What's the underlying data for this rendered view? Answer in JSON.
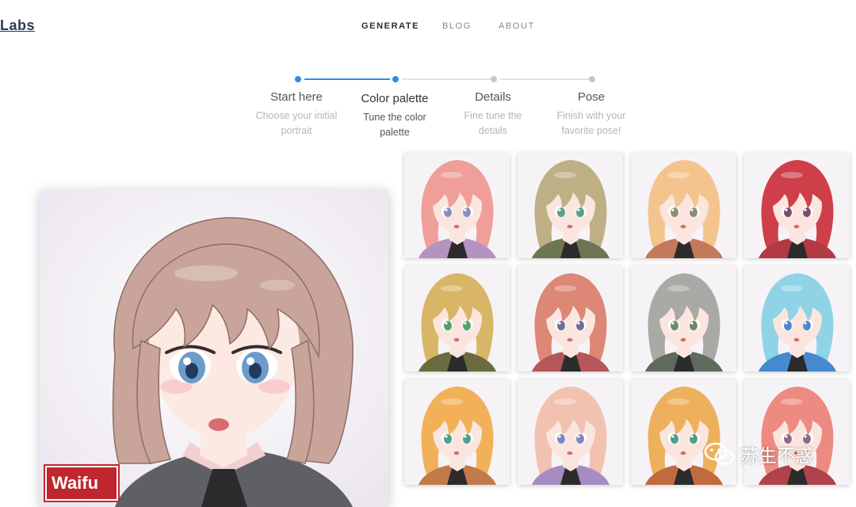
{
  "logo": {
    "text": "Labs"
  },
  "nav": {
    "items": [
      {
        "label": "GENERATE",
        "active": true
      },
      {
        "label": "BLOG",
        "active": false
      },
      {
        "label": "ABOUT",
        "active": false
      }
    ]
  },
  "stepper": {
    "current_step": 2,
    "steps": [
      {
        "title": "Start here",
        "description": "Choose your initial portrait"
      },
      {
        "title": "Color palette",
        "description": "Tune the color palette"
      },
      {
        "title": "Details",
        "description": "Fine tune the details"
      },
      {
        "title": "Pose",
        "description": "Finish with your favorite pose!"
      }
    ]
  },
  "main_portrait": {
    "hair": "#c8a49a",
    "hair_dark": "#8e6d68",
    "eyes": "#6c9bc9",
    "skin": "#fbe9e2",
    "shirt": "#5f5f66",
    "collar": "#f2cfd3",
    "tie": "#2b2b2b",
    "badge_text": "Waifu"
  },
  "variants": [
    {
      "hair": "#ef9e99",
      "eyes": "#8a8cc4",
      "shirt": "#b493c1"
    },
    {
      "hair": "#bfaf85",
      "eyes": "#5e9d86",
      "shirt": "#6e7553"
    },
    {
      "hair": "#f4c48f",
      "eyes": "#8f8c6c",
      "shirt": "#c27a5a"
    },
    {
      "hair": "#cf3f4a",
      "eyes": "#7b4d67",
      "shirt": "#b23a42"
    },
    {
      "hair": "#d9b667",
      "eyes": "#52a06a",
      "shirt": "#6a6b3f"
    },
    {
      "hair": "#dd8777",
      "eyes": "#6b6f94",
      "shirt": "#b5575a"
    },
    {
      "hair": "#a9a9a6",
      "eyes": "#6b8a6b",
      "shirt": "#5d6a5c"
    },
    {
      "hair": "#8fd4e6",
      "eyes": "#4a89cf",
      "shirt": "#4689cf"
    },
    {
      "hair": "#f2b058",
      "eyes": "#4aa08e",
      "shirt": "#c27a4b"
    },
    {
      "hair": "#f2c2b0",
      "eyes": "#7f87c2",
      "shirt": "#a78cc4"
    },
    {
      "hair": "#eeb05d",
      "eyes": "#4aa084",
      "shirt": "#c26a3f"
    },
    {
      "hair": "#ed8b82",
      "eyes": "#8a6a8a",
      "shirt": "#b0424c"
    }
  ],
  "watermark": {
    "text": "苏生不惑",
    "icon": "wechat-icon"
  }
}
